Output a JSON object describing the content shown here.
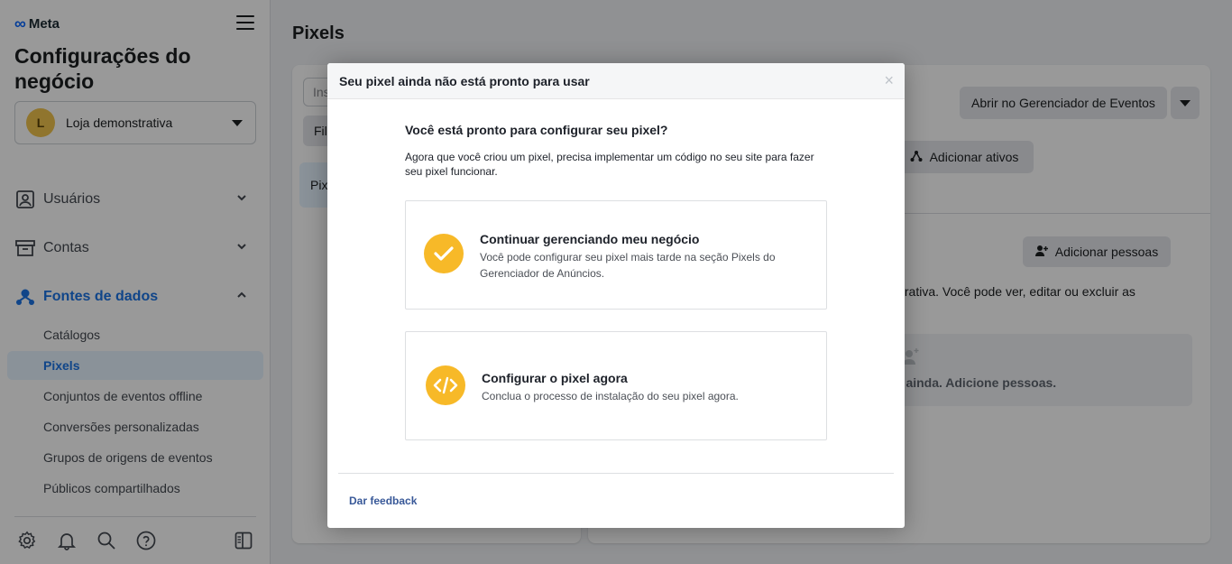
{
  "brand": {
    "name": "Meta"
  },
  "sidebar": {
    "title": "Configurações do negócio",
    "account": {
      "initial": "L",
      "name": "Loja demonstrativa"
    },
    "sections": [
      {
        "label": "Usuários",
        "icon": "user-badge-icon"
      },
      {
        "label": "Contas",
        "icon": "archive-box-icon"
      },
      {
        "label": "Fontes de dados",
        "icon": "data-sources-icon"
      }
    ],
    "data_source_items": [
      {
        "label": "Catálogos"
      },
      {
        "label": "Pixels"
      },
      {
        "label": "Conjuntos de eventos offline"
      },
      {
        "label": "Conversões personalizadas"
      },
      {
        "label": "Grupos de origens de eventos"
      },
      {
        "label": "Públicos compartilhados"
      }
    ],
    "footer_icons": [
      "settings-icon",
      "bell-icon",
      "search-icon",
      "help-icon",
      "panel-toggle-icon"
    ]
  },
  "main": {
    "page_title": "Pixels",
    "left_panel": {
      "search_placeholder": "Ins",
      "filter_label": "Fil",
      "pixel_row_label": "Pix"
    },
    "right_panel": {
      "open_events_manager": "Abrir no Gerenciador de Eventos",
      "add_assets": "Adicionar ativos",
      "add_people": "Adicionar pessoas",
      "info_text": "strativa. Você pode ver, editar ou excluir as",
      "empty_text": "o ainda. Adicione pessoas."
    }
  },
  "modal": {
    "title": "Seu pixel ainda não está pronto para usar",
    "close": "×",
    "question": "Você está pronto para configurar seu pixel?",
    "description": "Agora que você criou um pixel, precisa implementar um código no seu site para fazer seu pixel funcionar.",
    "options": [
      {
        "title": "Continuar gerenciando meu negócio",
        "description": "Você pode configurar seu pixel mais tarde na seção Pixels do Gerenciador de Anúncios.",
        "icon": "checkmark-icon"
      },
      {
        "title": "Configurar o pixel agora",
        "description": "Conclua o processo de instalação do seu pixel agora.",
        "icon": "code-icon"
      }
    ],
    "feedback": "Dar feedback"
  },
  "colors": {
    "accent": "#1b74e4",
    "option_icon": "#f7b928",
    "feedback_link": "#385898"
  }
}
